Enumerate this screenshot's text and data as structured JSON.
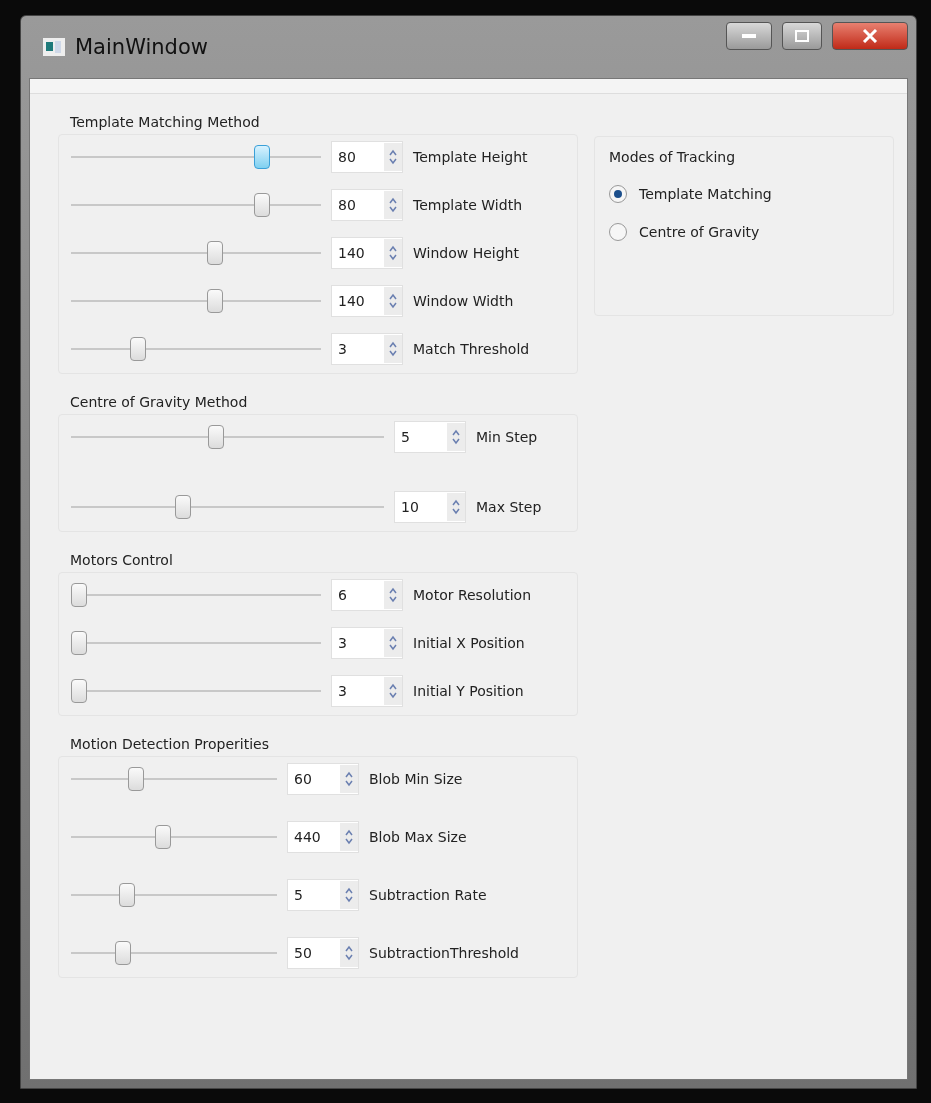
{
  "window": {
    "title": "MainWindow"
  },
  "groups": [
    {
      "title": "Template Matching Method",
      "rows": [
        {
          "label": "Template Height",
          "value": "80",
          "level": 0.78,
          "focused": true
        },
        {
          "label": "Template Width",
          "value": "80",
          "level": 0.78,
          "focused": false
        },
        {
          "label": "Window Height",
          "value": "140",
          "level": 0.58,
          "focused": false
        },
        {
          "label": "Window Width",
          "value": "140",
          "level": 0.58,
          "focused": false
        },
        {
          "label": "Match Threshold",
          "value": "3",
          "level": 0.25,
          "focused": false
        }
      ]
    },
    {
      "title": "Centre of Gravity Method",
      "rows": [
        {
          "label": "Min Step",
          "value": "5",
          "level": 0.46,
          "focused": false
        },
        {
          "label": "Max Step",
          "value": "10",
          "level": 0.35,
          "focused": false
        }
      ]
    },
    {
      "title": "Motors Control",
      "rows": [
        {
          "label": "Motor Resolution",
          "value": "6",
          "level": 0,
          "focused": false
        },
        {
          "label": "Initial X Position",
          "value": "3",
          "level": 0,
          "focused": false
        },
        {
          "label": "Initial Y Position",
          "value": "3",
          "level": 0,
          "focused": false
        }
      ]
    },
    {
      "title": "Motion Detection Properities",
      "rows": [
        {
          "label": "Blob Min Size",
          "value": "60",
          "level": 0.3,
          "focused": false
        },
        {
          "label": "Blob Max Size",
          "value": "440",
          "level": 0.44,
          "focused": false
        },
        {
          "label": "Subtraction Rate",
          "value": "5",
          "level": 0.25,
          "focused": false
        },
        {
          "label": "SubtractionThreshold",
          "value": "50",
          "level": 0.23,
          "focused": false
        }
      ]
    }
  ],
  "modes": {
    "title": "Modes of Tracking",
    "options": [
      {
        "label": "Template Matching",
        "selected": true
      },
      {
        "label": "Centre of Gravity",
        "selected": false
      }
    ]
  }
}
